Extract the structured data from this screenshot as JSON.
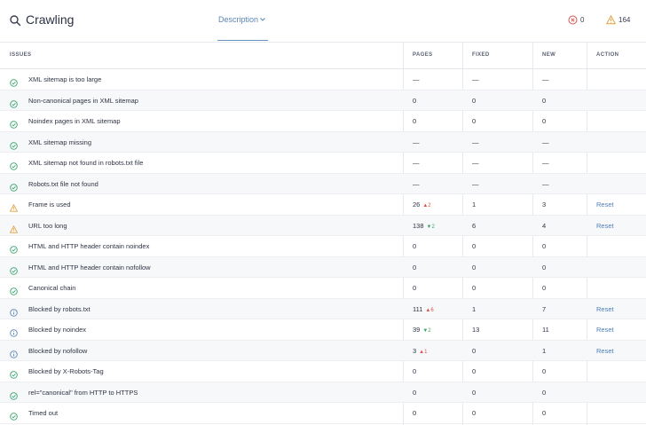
{
  "header": {
    "title": "Crawling",
    "description_tab": "Description",
    "errors_count": "0",
    "warnings_count": "164",
    "colors": {
      "error": "#d9534f",
      "warning": "#e6a23c",
      "accent": "#5b86b8"
    }
  },
  "columns": [
    "ISSUES",
    "PAGES",
    "FIXED",
    "NEW",
    "ACTION"
  ],
  "rows": [
    {
      "status": "ok",
      "issue": "XML sitemap is too large",
      "pages": "—",
      "delta": "",
      "fixed": "—",
      "new": "—",
      "action": ""
    },
    {
      "status": "ok",
      "issue": "Non-canonical pages in XML sitemap",
      "pages": "0",
      "delta": "",
      "fixed": "0",
      "new": "0",
      "action": ""
    },
    {
      "status": "ok",
      "issue": "Noindex pages in XML sitemap",
      "pages": "0",
      "delta": "",
      "fixed": "0",
      "new": "0",
      "action": ""
    },
    {
      "status": "ok",
      "issue": "XML sitemap missing",
      "pages": "—",
      "delta": "",
      "fixed": "—",
      "new": "—",
      "action": ""
    },
    {
      "status": "ok",
      "issue": "XML sitemap not found in robots.txt file",
      "pages": "—",
      "delta": "",
      "fixed": "—",
      "new": "—",
      "action": ""
    },
    {
      "status": "ok",
      "issue": "Robots.txt file not found",
      "pages": "—",
      "delta": "",
      "fixed": "—",
      "new": "—",
      "action": ""
    },
    {
      "status": "warning",
      "issue": "Frame is used",
      "pages": "26",
      "delta": "▲2",
      "delta_dir": "up",
      "fixed": "1",
      "new": "3",
      "action": "Reset"
    },
    {
      "status": "warning",
      "issue": "URL too long",
      "pages": "138",
      "delta": "▼2",
      "delta_dir": "dn",
      "fixed": "6",
      "new": "4",
      "action": "Reset"
    },
    {
      "status": "ok",
      "issue": "HTML and HTTP header contain noindex",
      "pages": "0",
      "delta": "",
      "fixed": "0",
      "new": "0",
      "action": ""
    },
    {
      "status": "ok",
      "issue": "HTML and HTTP header contain nofollow",
      "pages": "0",
      "delta": "",
      "fixed": "0",
      "new": "0",
      "action": ""
    },
    {
      "status": "ok",
      "issue": "Canonical chain",
      "pages": "0",
      "delta": "",
      "fixed": "0",
      "new": "0",
      "action": ""
    },
    {
      "status": "info",
      "issue": "Blocked by robots.txt",
      "pages": "111",
      "delta": "▲6",
      "delta_dir": "up",
      "fixed": "1",
      "new": "7",
      "action": "Reset"
    },
    {
      "status": "info",
      "issue": "Blocked by noindex",
      "pages": "39",
      "delta": "▼2",
      "delta_dir": "dn",
      "fixed": "13",
      "new": "11",
      "action": "Reset"
    },
    {
      "status": "info",
      "issue": "Blocked by nofollow",
      "pages": "3",
      "delta": "▲1",
      "delta_dir": "up",
      "fixed": "0",
      "new": "1",
      "action": "Reset"
    },
    {
      "status": "ok",
      "issue": "Blocked by X-Robots-Tag",
      "pages": "0",
      "delta": "",
      "fixed": "0",
      "new": "0",
      "action": ""
    },
    {
      "status": "ok",
      "issue": "rel=\"canonical\" from HTTP to HTTPS",
      "pages": "0",
      "delta": "",
      "fixed": "0",
      "new": "0",
      "action": ""
    },
    {
      "status": "ok",
      "issue": "Timed out",
      "pages": "0",
      "delta": "",
      "fixed": "0",
      "new": "0",
      "action": ""
    }
  ]
}
